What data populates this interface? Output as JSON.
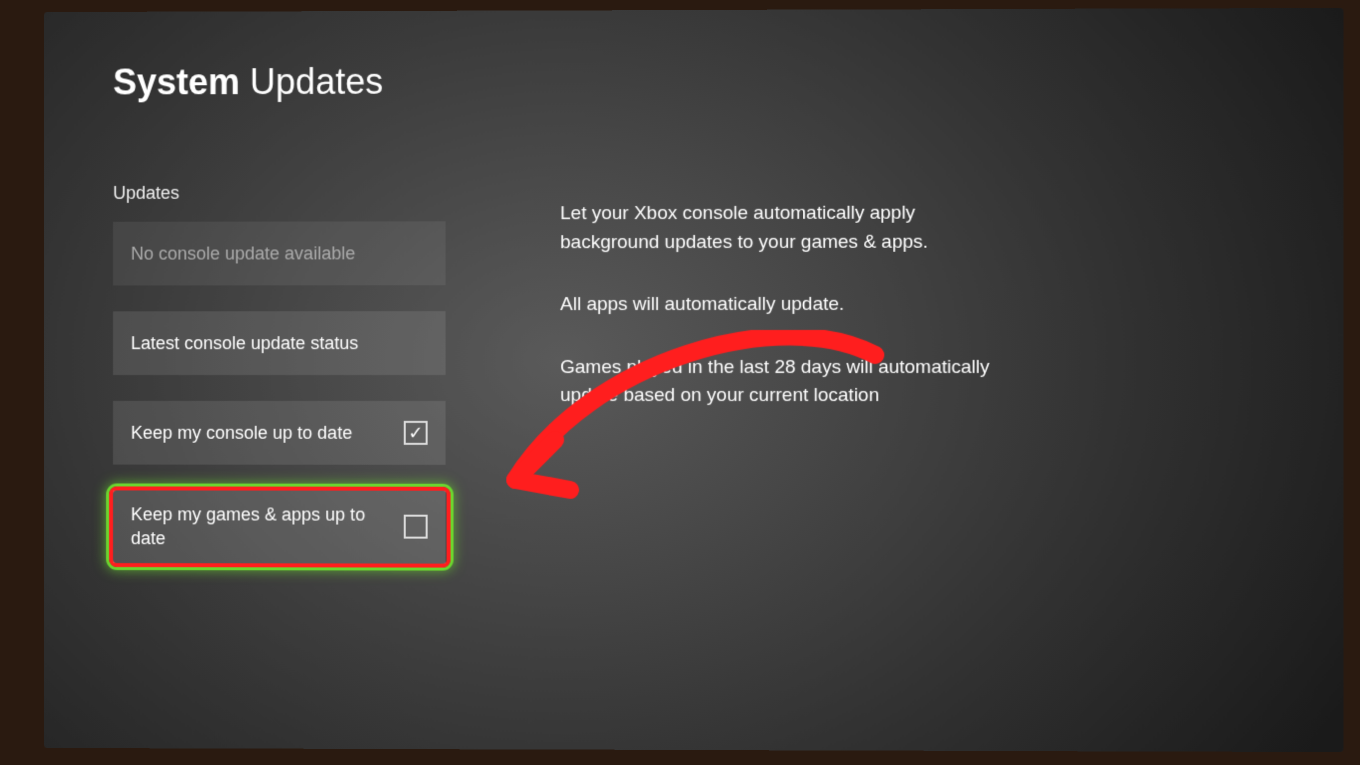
{
  "title": {
    "bold": "System",
    "light": "Updates"
  },
  "section_label": "Updates",
  "options": {
    "no_update": "No console update available",
    "latest_status": "Latest console update status",
    "keep_console": "Keep my console up to date",
    "keep_console_checked": "✓",
    "keep_games": "Keep my games & apps up to date",
    "keep_games_checked": ""
  },
  "description": {
    "p1": "Let your Xbox console automatically apply background updates to your games & apps.",
    "p2": "All apps will automatically update.",
    "p3": "Games played in the last 28 days will automatically update based on your current location"
  },
  "annotation": {
    "arrow_color": "#ff1e1e"
  }
}
